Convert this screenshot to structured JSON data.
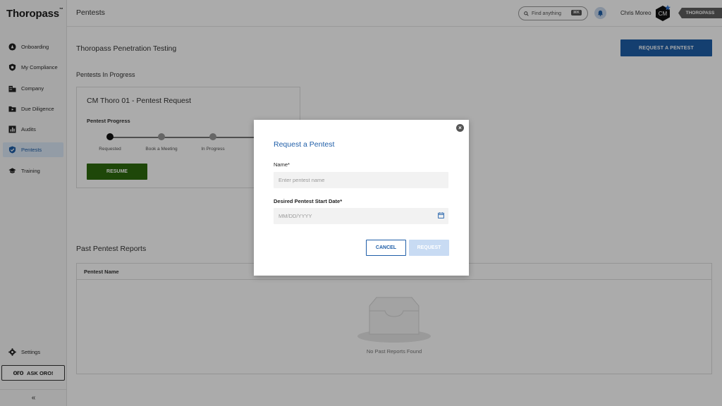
{
  "app": {
    "logo_text": "Thoropass",
    "logo_mark": "™"
  },
  "sidebar": {
    "items": [
      {
        "label": "Onboarding",
        "icon": "rocket-icon"
      },
      {
        "label": "My Compliance",
        "icon": "badge-icon"
      },
      {
        "label": "Company",
        "icon": "building-icon"
      },
      {
        "label": "Due Diligence",
        "icon": "folder-icon"
      },
      {
        "label": "Audits",
        "icon": "chart-icon"
      },
      {
        "label": "Pentests",
        "icon": "shield-icon",
        "active": true
      },
      {
        "label": "Training",
        "icon": "graduation-cap-icon"
      }
    ],
    "settings_label": "Settings",
    "ask_oro_logo": "oro",
    "ask_oro_label": "ASK ORO!",
    "collapse_glyph": "«"
  },
  "header": {
    "title": "Pentests",
    "search_placeholder": "Find anything",
    "search_shortcut": "⌘K",
    "user_name": "Chris Moreo",
    "avatar_initials": "CM",
    "org_badge": "THOROPASS"
  },
  "main": {
    "page_title": "Thoropass Penetration Testing",
    "request_button": "REQUEST A PENTEST",
    "in_progress_heading": "Pentests In Progress",
    "card": {
      "title": "CM Thoro 01 - Pentest Request",
      "progress_label": "Pentest Progress",
      "steps": [
        "Requested",
        "Book a Meeting",
        "In Progress"
      ],
      "resume_button": "RESUME"
    },
    "past_heading": "Past Pentest Reports",
    "table": {
      "column_header": "Pentest Name",
      "empty_text": "No Past Reports Found"
    }
  },
  "modal": {
    "title": "Request a Pentest",
    "name_label": "Name*",
    "name_placeholder": "Enter pentest name",
    "name_value": "",
    "date_label": "Desired Pentest Start Date*",
    "date_placeholder": "MM/DD/YYYY",
    "date_value": "",
    "cancel_button": "CANCEL",
    "request_button": "REQUEST",
    "close_glyph": "×"
  },
  "colors": {
    "primary": "#1f5ea8",
    "resume_green": "#2d6a0e",
    "disabled_button": "#c8dbf3",
    "active_nav_bg": "#dbe9f8"
  }
}
